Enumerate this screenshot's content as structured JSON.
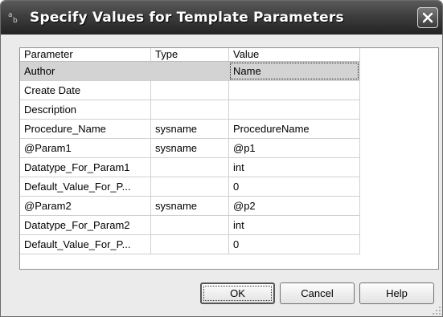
{
  "window": {
    "title": "Specify Values for Template Parameters",
    "icon": "template-params-icon",
    "icon_glyphs": [
      "a",
      "b"
    ]
  },
  "grid": {
    "columns": [
      "Parameter",
      "Type",
      "Value"
    ],
    "rows": [
      {
        "parameter": "Author",
        "type": "",
        "value": "Name"
      },
      {
        "parameter": "Create Date",
        "type": "",
        "value": ""
      },
      {
        "parameter": "Description",
        "type": "",
        "value": ""
      },
      {
        "parameter": "Procedure_Name",
        "type": "sysname",
        "value": "ProcedureName"
      },
      {
        "parameter": "@Param1",
        "type": "sysname",
        "value": "@p1"
      },
      {
        "parameter": "Datatype_For_Param1",
        "type": "",
        "value": "int"
      },
      {
        "parameter": "Default_Value_For_P...",
        "type": "",
        "value": "0"
      },
      {
        "parameter": "@Param2",
        "type": "sysname",
        "value": "@p2"
      },
      {
        "parameter": "Datatype_For_Param2",
        "type": "",
        "value": "int"
      },
      {
        "parameter": "Default_Value_For_P...",
        "type": "",
        "value": "0"
      }
    ]
  },
  "buttons": {
    "ok": "OK",
    "cancel": "Cancel",
    "help": "Help"
  },
  "colors": {
    "titlebar": "#3e3e3e",
    "dialog_bg": "#ebebeb",
    "selected_row": "#d3d3d3"
  }
}
